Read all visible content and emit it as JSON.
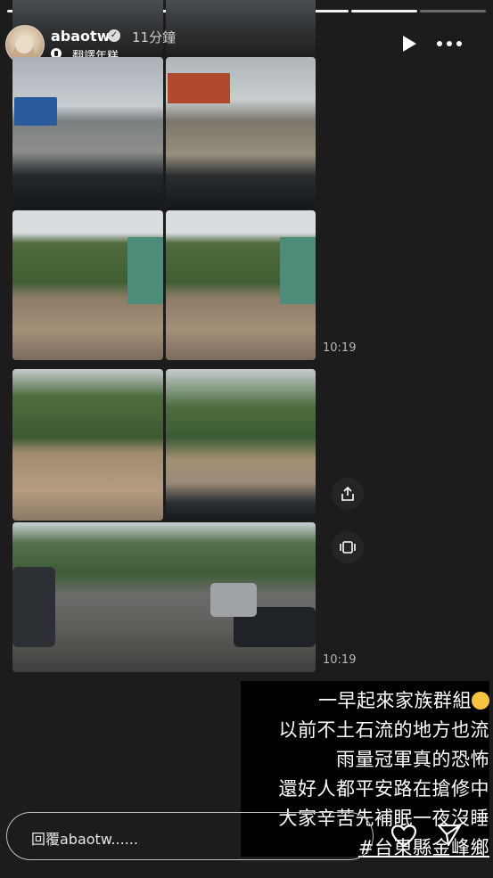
{
  "header": {
    "username": "abaotw",
    "time_ago": "11分鐘",
    "song": "翻譯年糕"
  },
  "progress": {
    "total_segments": 7,
    "completed_segments": 6
  },
  "timestamps": {
    "row2": "10:19",
    "row4": "10:19"
  },
  "caption": {
    "lines": [
      "一早起來家族群組",
      "以前不土石流的地方也流",
      "雨量冠軍真的恐怖",
      "還好人都平安路在搶修中",
      "大家辛苦先補眠一夜沒睡",
      "#台東縣金峰鄉"
    ]
  },
  "reply": {
    "placeholder": "回覆abaotw......"
  },
  "icons": {
    "play": "play-icon",
    "more": "more-options-icon",
    "share": "share-icon",
    "carousel": "carousel-icon",
    "like": "heart-icon",
    "send": "send-icon",
    "verified": "verified-badge-icon",
    "music": "music-note-icon"
  }
}
